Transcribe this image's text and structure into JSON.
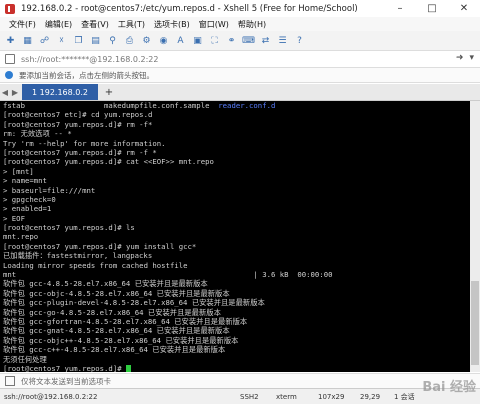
{
  "window": {
    "title": "192.168.0.2 - root@centos7:/etc/yum.repos.d - Xshell 5 (Free for Home/School)"
  },
  "menu": [
    "文件(F)",
    "编辑(E)",
    "查看(V)",
    "工具(T)",
    "选项卡(B)",
    "窗口(W)",
    "帮助(H)"
  ],
  "toolbar_icons": [
    "new-session-icon",
    "open-folder-icon",
    "connect-icon",
    "disconnect-icon",
    "copy-icon",
    "paste-icon",
    "find-icon",
    "print-icon",
    "settings-icon",
    "globe-icon",
    "font-icon",
    "color-icon",
    "fullscreen-icon",
    "lock-icon",
    "keyboard-icon",
    "transfer-icon",
    "script-icon",
    "help-icon"
  ],
  "address": {
    "value": "ssh://root:*******@192.168.0.2:22"
  },
  "hint": {
    "text": "要添加当前会话，点击左侧的箭头按钮。"
  },
  "tab": {
    "label": "1 192.168.0.2"
  },
  "terminal": {
    "lines": [
      {
        "text": "fstab                  makedumpfile.conf.sample  ",
        "dir": "reader.conf.d"
      },
      {
        "text": "[root@centos7 etc]# cd yum.repos.d"
      },
      {
        "text": "[root@centos7 yum.repos.d]# rm -f*"
      },
      {
        "text": "rm: 无效选项 -- *"
      },
      {
        "text": "Try 'rm --help' for more information."
      },
      {
        "text": "[root@centos7 yum.repos.d]# rm -f *"
      },
      {
        "text": "[root@centos7 yum.repos.d]# cat <<EOF>> mnt.repo"
      },
      {
        "text": "> [mnt]"
      },
      {
        "text": "> name=mnt"
      },
      {
        "text": "> baseurl=file:///mnt"
      },
      {
        "text": "> gpgcheck=0"
      },
      {
        "text": "> enabled=1"
      },
      {
        "text": "> EOF"
      },
      {
        "text": "[root@centos7 yum.repos.d]# ls"
      },
      {
        "text": "mnt.repo"
      },
      {
        "text": "[root@centos7 yum.repos.d]# yum install gcc*"
      },
      {
        "text": "已加载插件：fastestmirror, langpacks"
      },
      {
        "text": "Loading mirror speeds from cached hostfile"
      },
      {
        "text": "mnt                                                      | 3.6 kB  00:00:00"
      },
      {
        "text": "软件包 gcc-4.8.5-28.el7.x86_64 已安装并且是最新版本"
      },
      {
        "text": "软件包 gcc-objc-4.8.5-28.el7.x86_64 已安装并且是最新版本"
      },
      {
        "text": "软件包 gcc-plugin-devel-4.8.5-28.el7.x86_64 已安装并且是最新版本"
      },
      {
        "text": "软件包 gcc-go-4.8.5-28.el7.x86_64 已安装并且是最新版本"
      },
      {
        "text": "软件包 gcc-gfortran-4.8.5-28.el7.x86_64 已安装并且是最新版本"
      },
      {
        "text": "软件包 gcc-gnat-4.8.5-28.el7.x86_64 已安装并且是最新版本"
      },
      {
        "text": "软件包 gcc-objc++-4.8.5-28.el7.x86_64 已安装并且是最新版本"
      },
      {
        "text": "软件包 gcc-c++-4.8.5-28.el7.x86_64 已安装并且是最新版本"
      },
      {
        "text": "无须任何处理"
      },
      {
        "text": "[root@centos7 yum.repos.d]# ",
        "cursor": true
      }
    ]
  },
  "inputbar": {
    "placeholder": "仅将文本发送到当前选项卡"
  },
  "status": {
    "connection": "ssh://root@192.168.0.2:22",
    "protocol": "SSH2",
    "terminal": "xterm",
    "size": "107x29",
    "position": "29,29",
    "sessions": "1 会话"
  },
  "watermark": {
    "text": "Bai 经验"
  },
  "colors": {
    "tab_active": "#2f5fa6",
    "terminal_bg": "#000000",
    "directory": "#5a7fff",
    "cursor": "#2ecc40"
  }
}
